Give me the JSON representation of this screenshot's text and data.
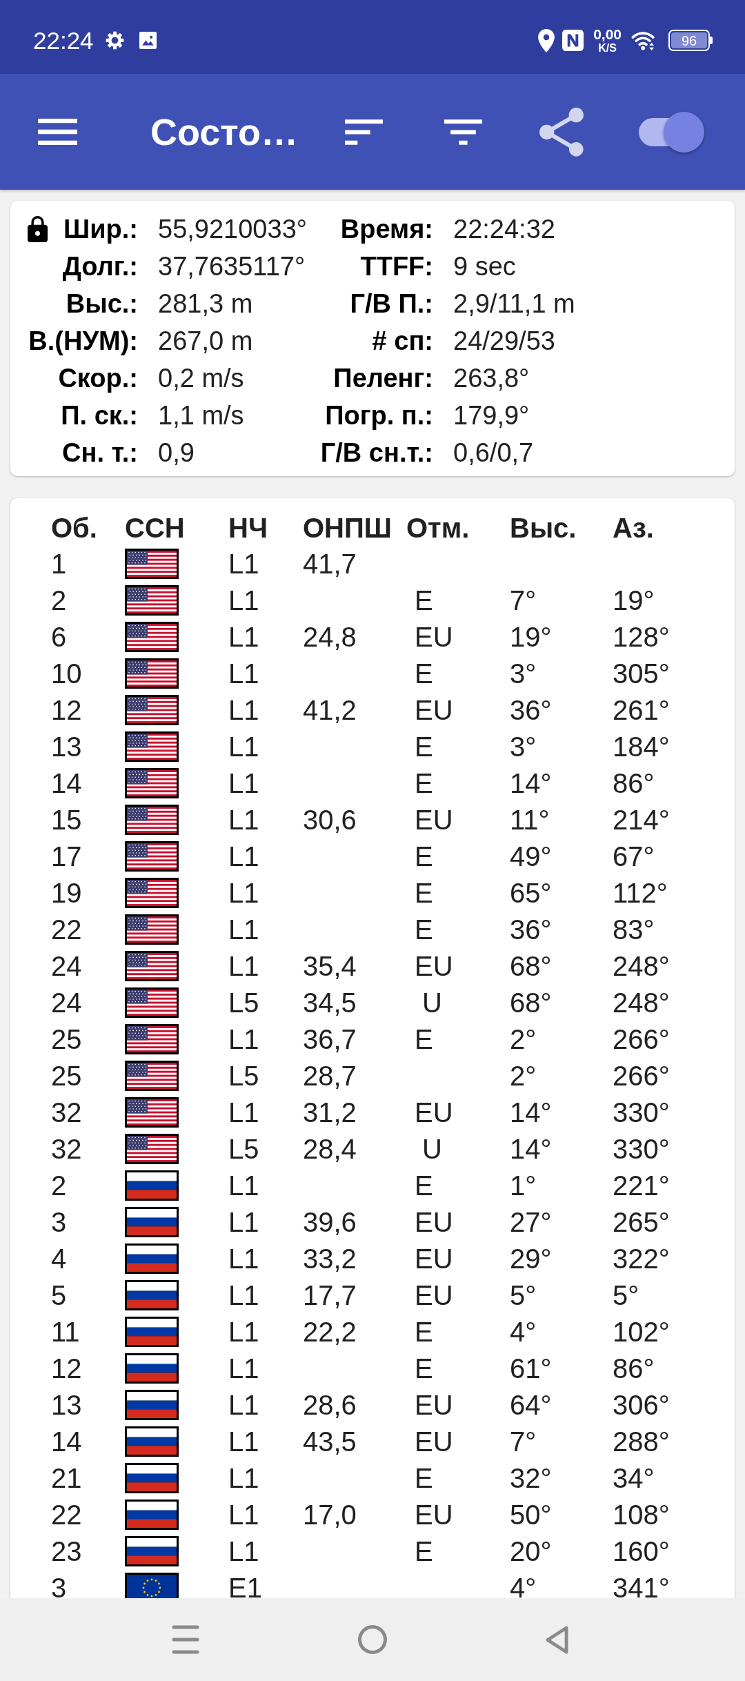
{
  "status_bar": {
    "time": "22:24",
    "net_speed": "0,00",
    "net_speed_unit": "K/S",
    "battery": "96"
  },
  "app_bar": {
    "title": "Состо…",
    "toggle": {
      "on": true
    }
  },
  "fix_card": {
    "locked": true,
    "rows": [
      {
        "left": {
          "label": "Шир.:",
          "value": "55,9210033°"
        },
        "right": {
          "label": "Время:",
          "value": "22:24:32"
        }
      },
      {
        "left": {
          "label": "Долг.:",
          "value": "37,7635117°"
        },
        "right": {
          "label": "TTFF:",
          "value": "9 sec"
        }
      },
      {
        "left": {
          "label": "Выс.:",
          "value": "281,3 m"
        },
        "right": {
          "label": "Г/В П.:",
          "value": "2,9/11,1 m"
        }
      },
      {
        "left": {
          "label": "В.(НУМ):",
          "value": "267,0 m"
        },
        "right": {
          "label": "# сп:",
          "value": "24/29/53"
        }
      },
      {
        "left": {
          "label": "Скор.:",
          "value": "0,2 m/s"
        },
        "right": {
          "label": "Пеленг:",
          "value": "263,8°"
        }
      },
      {
        "left": {
          "label": "П. ск.:",
          "value": "1,1 m/s"
        },
        "right": {
          "label": "Погр. п.:",
          "value": "179,9°"
        }
      },
      {
        "left": {
          "label": "Сн. т.:",
          "value": "0,9"
        },
        "right": {
          "label": "Г/В сн.т.:",
          "value": "0,6/0,7"
        }
      }
    ]
  },
  "satellites": {
    "columns": [
      "Об.",
      "ССН",
      "НЧ",
      "ОНПШ",
      "Отм.",
      "Выс.",
      "Аз."
    ],
    "rows": [
      {
        "id": "1",
        "kind": "us",
        "band": "L1",
        "cn0": "41,7"
      },
      {
        "id": "2",
        "kind": "us",
        "band": "L1",
        "flags": "E",
        "elevation": "7°",
        "azimuth": "19°"
      },
      {
        "id": "6",
        "kind": "us",
        "band": "L1",
        "cn0": "24,8",
        "flags": "EU",
        "elevation": "19°",
        "azimuth": "128°"
      },
      {
        "id": "10",
        "kind": "us",
        "band": "L1",
        "flags": "E",
        "elevation": "3°",
        "azimuth": "305°"
      },
      {
        "id": "12",
        "kind": "us",
        "band": "L1",
        "cn0": "41,2",
        "flags": "EU",
        "elevation": "36°",
        "azimuth": "261°"
      },
      {
        "id": "13",
        "kind": "us",
        "band": "L1",
        "flags": "E",
        "elevation": "3°",
        "azimuth": "184°"
      },
      {
        "id": "14",
        "kind": "us",
        "band": "L1",
        "flags": "E",
        "elevation": "14°",
        "azimuth": "86°"
      },
      {
        "id": "15",
        "kind": "us",
        "band": "L1",
        "cn0": "30,6",
        "flags": "EU",
        "elevation": "11°",
        "azimuth": "214°"
      },
      {
        "id": "17",
        "kind": "us",
        "band": "L1",
        "flags": "E",
        "elevation": "49°",
        "azimuth": "67°"
      },
      {
        "id": "19",
        "kind": "us",
        "band": "L1",
        "flags": "E",
        "elevation": "65°",
        "azimuth": "112°"
      },
      {
        "id": "22",
        "kind": "us",
        "band": "L1",
        "flags": "E",
        "elevation": "36°",
        "azimuth": "83°"
      },
      {
        "id": "24",
        "kind": "us",
        "band": "L1",
        "cn0": "35,4",
        "flags": "EU",
        "elevation": "68°",
        "azimuth": "248°"
      },
      {
        "id": "24",
        "kind": "us",
        "band": "L5",
        "cn0": "34,5",
        "flags": " U",
        "elevation": "68°",
        "azimuth": "248°"
      },
      {
        "id": "25",
        "kind": "us",
        "band": "L1",
        "cn0": "36,7",
        "flags": "E",
        "elevation": "2°",
        "azimuth": "266°"
      },
      {
        "id": "25",
        "kind": "us",
        "band": "L5",
        "cn0": "28,7",
        "elevation": "2°",
        "azimuth": "266°"
      },
      {
        "id": "32",
        "kind": "us",
        "band": "L1",
        "cn0": "31,2",
        "flags": "EU",
        "elevation": "14°",
        "azimuth": "330°"
      },
      {
        "id": "32",
        "kind": "us",
        "band": "L5",
        "cn0": "28,4",
        "flags": " U",
        "elevation": "14°",
        "azimuth": "330°"
      },
      {
        "id": "2",
        "kind": "ru",
        "band": "L1",
        "flags": "E",
        "elevation": "1°",
        "azimuth": "221°"
      },
      {
        "id": "3",
        "kind": "ru",
        "band": "L1",
        "cn0": "39,6",
        "flags": "EU",
        "elevation": "27°",
        "azimuth": "265°"
      },
      {
        "id": "4",
        "kind": "ru",
        "band": "L1",
        "cn0": "33,2",
        "flags": "EU",
        "elevation": "29°",
        "azimuth": "322°"
      },
      {
        "id": "5",
        "kind": "ru",
        "band": "L1",
        "cn0": "17,7",
        "flags": "EU",
        "elevation": "5°",
        "azimuth": "5°"
      },
      {
        "id": "11",
        "kind": "ru",
        "band": "L1",
        "cn0": "22,2",
        "flags": "E",
        "elevation": "4°",
        "azimuth": "102°"
      },
      {
        "id": "12",
        "kind": "ru",
        "band": "L1",
        "flags": "E",
        "elevation": "61°",
        "azimuth": "86°"
      },
      {
        "id": "13",
        "kind": "ru",
        "band": "L1",
        "cn0": "28,6",
        "flags": "EU",
        "elevation": "64°",
        "azimuth": "306°"
      },
      {
        "id": "14",
        "kind": "ru",
        "band": "L1",
        "cn0": "43,5",
        "flags": "EU",
        "elevation": "7°",
        "azimuth": "288°"
      },
      {
        "id": "21",
        "kind": "ru",
        "band": "L1",
        "flags": "E",
        "elevation": "32°",
        "azimuth": "34°"
      },
      {
        "id": "22",
        "kind": "ru",
        "band": "L1",
        "cn0": "17,0",
        "flags": "EU",
        "elevation": "50°",
        "azimuth": "108°"
      },
      {
        "id": "23",
        "kind": "ru",
        "band": "L1",
        "flags": "E",
        "elevation": "20°",
        "azimuth": "160°"
      },
      {
        "id": "3",
        "kind": "eu",
        "band": "E1",
        "elevation": "4°",
        "azimuth": "341°"
      }
    ]
  }
}
